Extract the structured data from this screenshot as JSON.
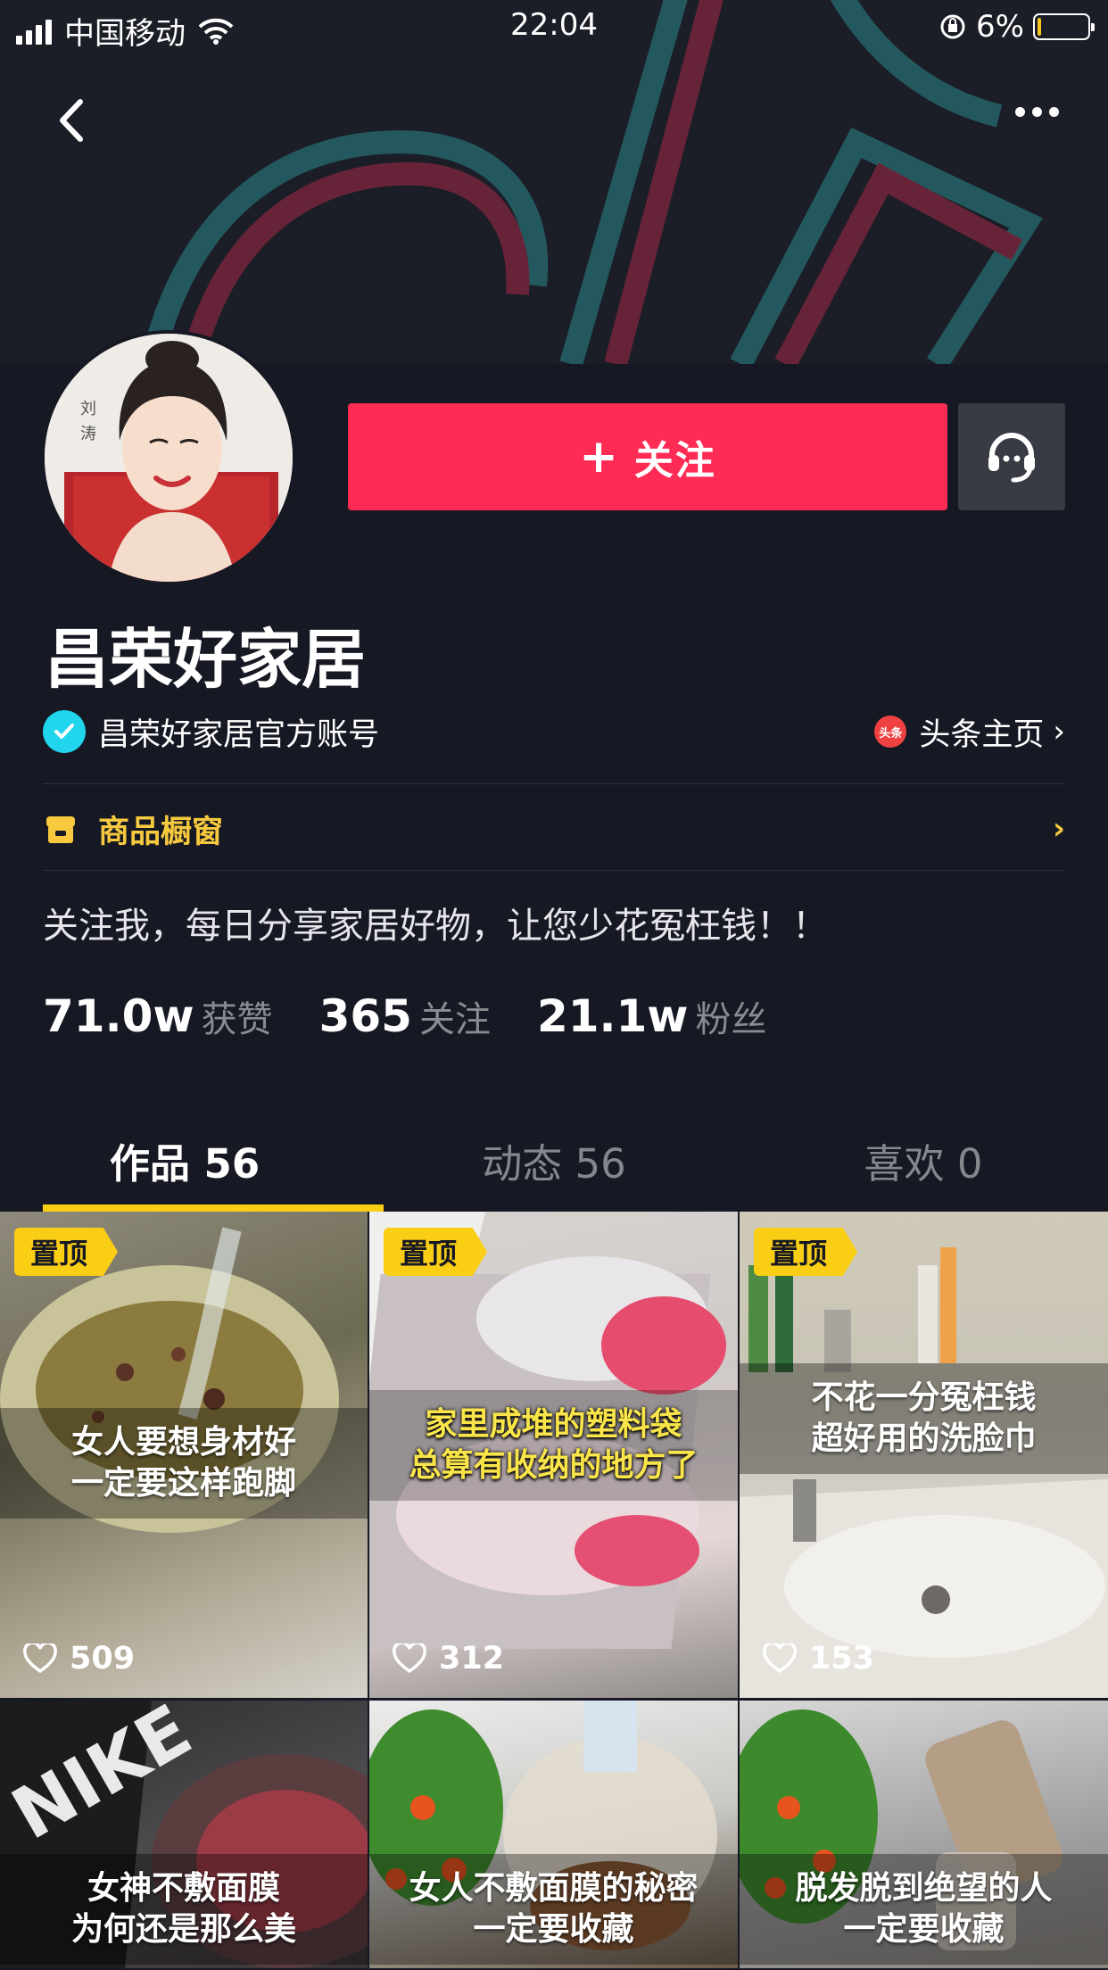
{
  "status_bar": {
    "carrier": "中国移动",
    "time": "22:04",
    "battery": "6%"
  },
  "profile": {
    "name": "昌荣好家居",
    "verified_text": "昌荣好家居官方账号",
    "toutiao_badge": "头条",
    "toutiao_link": "头条主页",
    "follow_label": "关注",
    "shop_label": "商品橱窗",
    "bio": "关注我，每日分享家居好物，让您少花冤枉钱！！",
    "stats": [
      {
        "value": "71.0w",
        "label": "获赞"
      },
      {
        "value": "365",
        "label": "关注"
      },
      {
        "value": "21.1w",
        "label": "粉丝"
      }
    ]
  },
  "tabs": [
    {
      "label": "作品 56",
      "active": true
    },
    {
      "label": "动态 56",
      "active": false
    },
    {
      "label": "喜欢 0",
      "active": false
    }
  ],
  "videos": [
    {
      "pinned": "置顶",
      "caption": "女人要想身材好\n一定要这样跑脚",
      "likes": "509"
    },
    {
      "pinned": "置顶",
      "caption": "家里成堆的塑料袋\n总算有收纳的地方了",
      "likes": "312"
    },
    {
      "pinned": "置顶",
      "caption": "不花一分冤枉钱\n超好用的洗脸巾",
      "likes": "153"
    },
    {
      "caption": "女神不敷面膜\n为何还是那么美"
    },
    {
      "caption": "女人不敷面膜的秘密\n一定要收藏"
    },
    {
      "caption": "脱发脱到绝望的人\n一定要收藏"
    }
  ],
  "colors": {
    "accent": "#fe2c55",
    "highlight": "#face15",
    "verify": "#20d5ec",
    "background": "#161823"
  }
}
